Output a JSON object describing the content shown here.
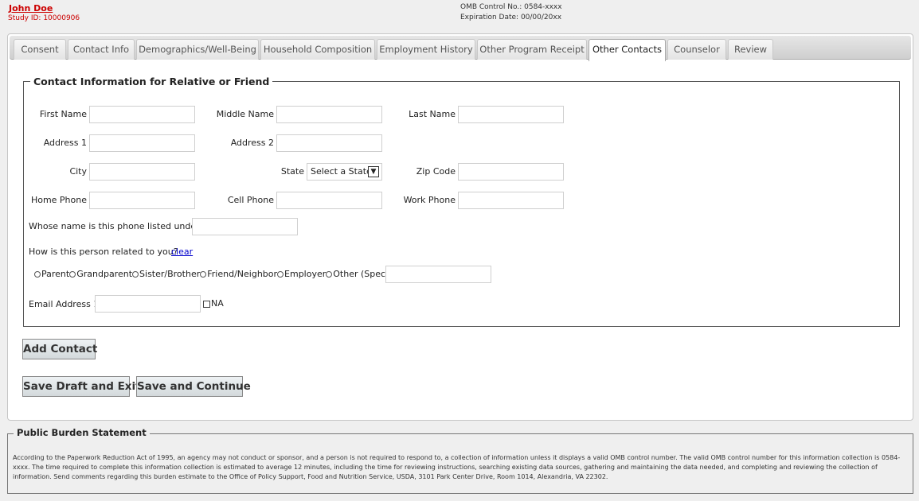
{
  "header": {
    "user_name": "John Doe",
    "study_id": "Study ID: 10000906",
    "omb_control": "OMB Control No.: 0584-xxxx",
    "expiration": "Expiration Date: 00/00/20xx"
  },
  "tabs": [
    {
      "label": "Consent"
    },
    {
      "label": "Contact Info"
    },
    {
      "label": "Demographics/Well-Being"
    },
    {
      "label": "Household Composition"
    },
    {
      "label": "Employment History"
    },
    {
      "label": "Other Program Receipt"
    },
    {
      "label": "Other Contacts",
      "active": true
    },
    {
      "label": "Counselor"
    },
    {
      "label": "Review"
    }
  ],
  "form": {
    "legend": "Contact Information for Relative or Friend",
    "first_name_label": "First Name",
    "middle_name_label": "Middle Name",
    "last_name_label": "Last Name",
    "address1_label": "Address 1",
    "address2_label": "Address 2",
    "city_label": "City",
    "state_label": "State",
    "state_value": "Select a State",
    "zip_label": "Zip Code",
    "home_phone_label": "Home Phone",
    "cell_phone_label": "Cell Phone",
    "work_phone_label": "Work Phone",
    "phone_owner_label": "Whose name is this phone listed under?",
    "relation_question": "How is this person related to you?",
    "clear_link": "clear",
    "relation_options": [
      "Parent",
      "Grandparent",
      "Sister/Brother",
      "Friend/Neighbor",
      "Employer",
      "Other (Specify)"
    ],
    "email_label": "Email Address 1",
    "na_label": "NA"
  },
  "buttons": {
    "add_contact": "Add Contact",
    "save_draft": "Save Draft and Exit",
    "save_continue": "Save and Continue"
  },
  "burden": {
    "legend": "Public Burden Statement",
    "text": "According to the Paperwork Reduction Act of 1995, an agency may not conduct or sponsor, and a person is not required to respond to, a collection of information unless it displays a valid OMB control number. The valid OMB control number for this information collection is 0584-xxxx. The time required to complete this information collection is estimated to average 12 minutes, including the time for reviewing instructions, searching existing data sources, gathering and maintaining the data needed, and completing and reviewing the collection of information. Send comments regarding this burden estimate to the Office of Policy Support, Food and Nutrition Service, USDA, 3101 Park Center Drive, Room 1014, Alexandria, VA 22302."
  }
}
